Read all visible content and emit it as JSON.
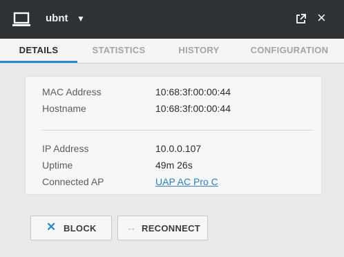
{
  "window": {
    "title": "ubnt",
    "icons": {
      "device": "laptop-icon",
      "dropdown": "caret-down-icon",
      "popout": "popout-icon",
      "close": "close-icon"
    },
    "close_glyph": "×",
    "caret_glyph": "▼"
  },
  "tabs": [
    {
      "label": "DETAILS",
      "active": true
    },
    {
      "label": "STATISTICS",
      "active": false
    },
    {
      "label": "HISTORY",
      "active": false
    },
    {
      "label": "CONFIGURATION",
      "active": false
    }
  ],
  "details": {
    "mac_label": "MAC Address",
    "mac_value": "10:68:3f:00:00:44",
    "hostname_label": "Hostname",
    "hostname_value": "10:68:3f:00:00:44",
    "ip_label": "IP Address",
    "ip_value": "10.0.0.107",
    "uptime_label": "Uptime",
    "uptime_value": "49m 26s",
    "ap_label": "Connected AP",
    "ap_value": "UAP AC Pro C"
  },
  "actions": {
    "block_label": "BLOCK",
    "block_glyph": "✕",
    "reconnect_label": "RECONNECT",
    "reconnect_glyph": "↔"
  },
  "colors": {
    "titlebar": "#2f3235",
    "accent": "#2a88c8",
    "link": "#2b7ec4",
    "block_icon": "#2a88c8",
    "reconnect_icon": "#9ec6e6"
  }
}
